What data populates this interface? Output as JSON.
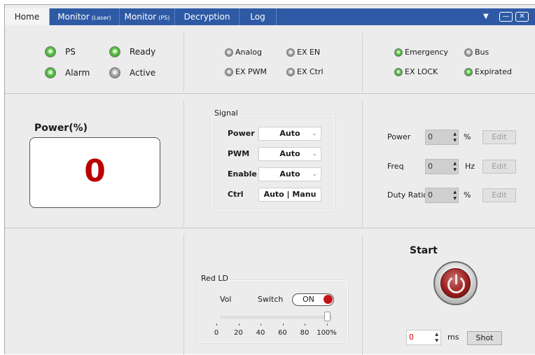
{
  "tabs": [
    {
      "label": "Home",
      "sub": ""
    },
    {
      "label": "Monitor",
      "sub": "(Laser)"
    },
    {
      "label": "Monitor",
      "sub": "(PS)"
    },
    {
      "label": "Decryption",
      "sub": ""
    },
    {
      "label": "Log",
      "sub": ""
    }
  ],
  "window_controls": {
    "dropdown": "▼",
    "minimize": "—",
    "close": "✕"
  },
  "status_left": [
    {
      "label": "PS",
      "state": "green"
    },
    {
      "label": "Ready",
      "state": "green"
    },
    {
      "label": "Alarm",
      "state": "green"
    },
    {
      "label": "Active",
      "state": "gray"
    }
  ],
  "status_mid": [
    {
      "label": "Analog",
      "state": "gray"
    },
    {
      "label": "EX EN",
      "state": "gray"
    },
    {
      "label": "EX PWM",
      "state": "gray"
    },
    {
      "label": "EX Ctrl",
      "state": "gray"
    }
  ],
  "status_right": [
    {
      "label": "Emergency",
      "state": "green"
    },
    {
      "label": "Bus",
      "state": "gray"
    },
    {
      "label": "EX LOCK",
      "state": "green"
    },
    {
      "label": "Expirated",
      "state": "green"
    }
  ],
  "power_display": {
    "title": "Power(%)",
    "value": "0",
    "color": "#b00000"
  },
  "signal": {
    "title": "Signal",
    "rows": [
      {
        "label": "Power",
        "value": "Auto"
      },
      {
        "label": "PWM",
        "value": "Auto"
      },
      {
        "label": "Enable",
        "value": "Auto"
      },
      {
        "label": "Ctrl",
        "value": "Auto | Manu"
      }
    ]
  },
  "params": [
    {
      "label": "Power",
      "value": "0",
      "unit": "%",
      "button": "Edit"
    },
    {
      "label": "Freq",
      "value": "0",
      "unit": "Hz",
      "button": "Edit"
    },
    {
      "label": "Duty Ratio",
      "value": "0",
      "unit": "%",
      "button": "Edit"
    }
  ],
  "red_ld": {
    "title": "Red LD",
    "vol_label": "Vol",
    "switch_label": "Switch",
    "switch_state": "ON",
    "slider_percent": 100,
    "ticks": [
      "0",
      "20",
      "40",
      "60",
      "80",
      "100%"
    ]
  },
  "start": {
    "title": "Start",
    "ms_value": "0",
    "ms_unit": "ms",
    "shot_label": "Shot"
  },
  "colors": {
    "tab_bar": "#2e5aa5",
    "led_green": "#3ea82e",
    "accent_red": "#c4151b"
  }
}
